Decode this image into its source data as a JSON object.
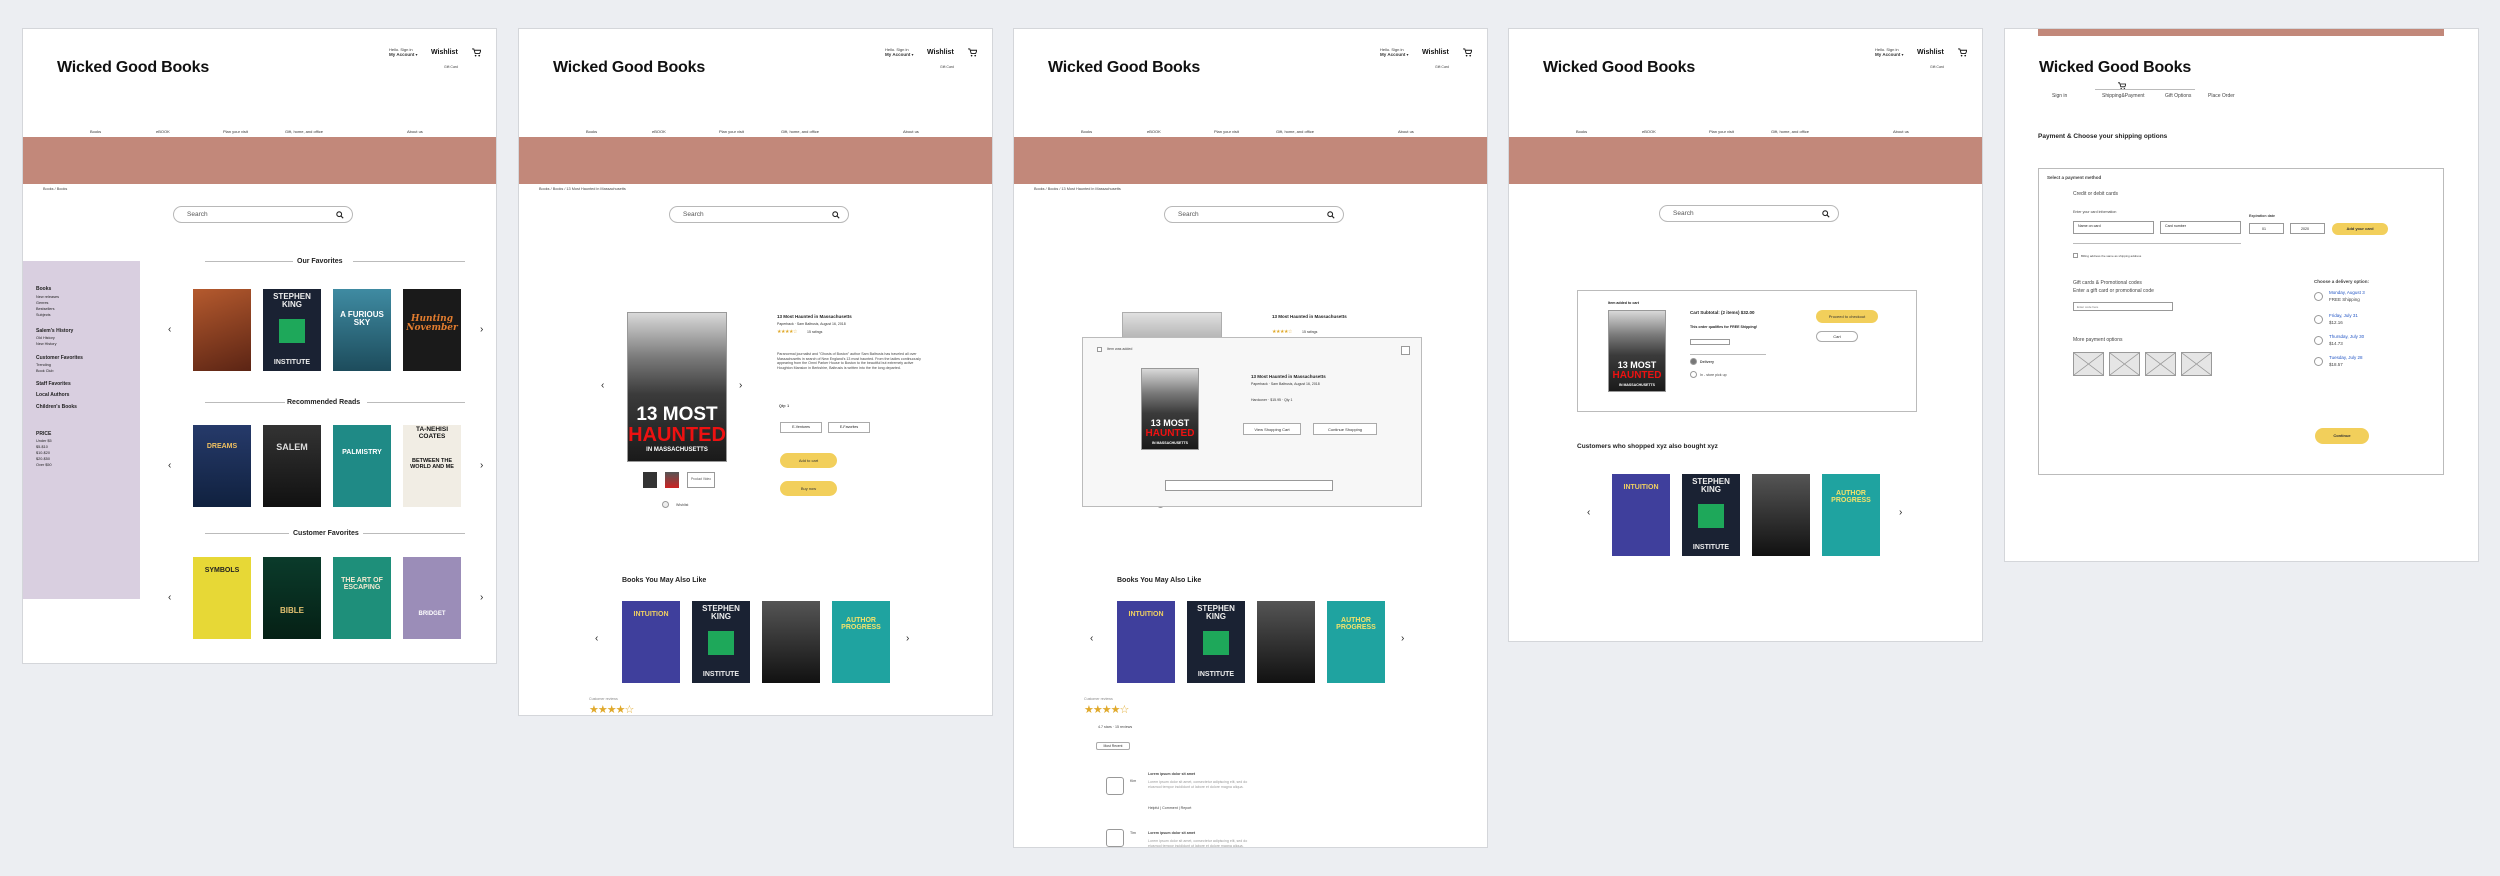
{
  "header": {
    "logo": "Wicked Good Books",
    "account_hello": "Hello. Sign in",
    "account_label": "My Account",
    "wishlist": "Wishlist",
    "gift_card": "Gift Card",
    "cart_icon": "cart-icon"
  },
  "nav": [
    "Books",
    "eBOOK",
    "Plan your visit",
    "Gift, home, and office",
    "About us"
  ],
  "search": {
    "placeholder": "Search"
  },
  "crumbs": {
    "f1": "Books / Books",
    "f2": "Books / Books / 13 Most Haunted in Massachusetts",
    "f3": "Books / Books / 13 Most Haunted in Massachusetts"
  },
  "frame1": {
    "sidebar": {
      "books": "Books",
      "books_items": [
        "New releases",
        "Genres",
        "Bestsellers",
        "Subjects"
      ],
      "salem": "Salem's History",
      "salem_items": [
        "Old History",
        "New History"
      ],
      "favorites": "Customer Favorites",
      "favorites_items": [
        "Trending",
        "Book Club"
      ],
      "staff": "Staff Favorites",
      "local": "Local Authors",
      "children": "Children's Books",
      "price": "PRICE",
      "price_items": [
        "Under $5",
        "$5-$10",
        "$10-$20",
        "$20-$50",
        "Over $50"
      ]
    },
    "sections": [
      "Our Favorites",
      "Recommended Reads",
      "Customer Favorites"
    ],
    "row1": [
      "",
      "STEPHEN KING",
      "A FURIOUS SKY",
      "Hunting November"
    ],
    "row1_sub": [
      "",
      "INSTITUTE",
      "",
      ""
    ],
    "row2": [
      "DREAMS",
      "SALEM",
      "PALMISTRY",
      "TA-NEHISI COATES"
    ],
    "row2_sub": [
      "",
      "",
      "",
      "BETWEEN THE WORLD AND ME"
    ],
    "row3": [
      "SYMBOLS",
      "BIBLE",
      "THE ART OF ESCAPING",
      "BRIDGET"
    ],
    "row3_sub": [
      "",
      "",
      "",
      ""
    ]
  },
  "product": {
    "cover_13": "13 MOST",
    "cover_haunted": "HAUNTED",
    "cover_in": "IN MASSACHUSETTS",
    "title": "13 Most Haunted in Massachusetts",
    "meta": "Paperback · Sam Baltrusis, August 16, 2018",
    "stars": "★★★★☆",
    "ratings": "15 ratings",
    "description": "Paranormal journalist and \"Ghosts of Boston\" author Sam Baltrusis has traveled all over Massachusetts in search of New England's 13 most haunted. From the ladies continuously appearing from the Omni Parker House to Boston to the beautiful but extremely active Houghton Mansion in Berkshire, Baltrusis is written into the the long departed.",
    "qty": "Qty: 1",
    "format1": "E-Ventures",
    "format2": "E-Favorites",
    "add_to_cart": "Add to cart",
    "buy_now": "Buy now",
    "wishlist": "Wishlist",
    "thumb_more": "Product Video",
    "you_may_like": "Books You May Also Like",
    "customer_reviews": "Customer reviews",
    "review_stars": "★★★★☆"
  },
  "frame3": {
    "modal_check": "Item was added",
    "view_cart": "View Shopping Cart",
    "continue": "Continue Shopping",
    "modal_hard": "Hardcover · $15.95 · Qty 1",
    "review_count": "4.7 stars · 15 reviews",
    "filter": "Most Recent",
    "review_title": "Lorem ipsum dolor sit amet",
    "review_body": "Lorem ipsum dolor sit amet, consectetur adipiscing elit, sed do eiusmod tempor incididunt ut labore et dolore magna aliqua.",
    "review_actions": "Helpful  |  Comment  |  Report",
    "reviewer1": "Kim",
    "reviewer2": "Tim"
  },
  "frame4": {
    "added": "Item added to cart",
    "subtotal": "Cart Subtotal: (2 items) $32.00",
    "free_shipping": "This order qualifies for FREE Shipping!",
    "proceed": "Proceed to checkout",
    "cart": "Cart",
    "delivery": "Delivery",
    "pickup": "In - store pick up",
    "also_bought": "Customers who shopped xyz also bought xyz",
    "books": [
      "INTUITION",
      "STEPHEN KING",
      "",
      "AUTHOR PROGRESS"
    ]
  },
  "frame5": {
    "steps": [
      "Sign in",
      "Shipping&Payment",
      "Gift Options",
      "Place Order"
    ],
    "heading": "Payment & Choose your shipping options",
    "select_method": "Select a payment method",
    "credit": "Credit or debit cards",
    "enter_card": "Enter your card information",
    "name_on_card": "Name on card",
    "card_number": "Card number",
    "expiration": "Expiration date",
    "month": "01",
    "year": "2020",
    "add_card": "Add your card",
    "billing_check": "Billing address the same as shipping address",
    "gift_heading": "Gift cards & Promotional codes",
    "gift_sub": "Enter a gift card or promotional code",
    "code_placeholder": "Enter code here",
    "more_options": "More payment options",
    "delivery_heading": "Choose a delivery option:",
    "delivery": [
      {
        "date": "Monday, August 3",
        "price": "FREE Shipping"
      },
      {
        "date": "Friday, July 31",
        "price": "$12.16"
      },
      {
        "date": "Thursday, July 30",
        "price": "$14.73"
      },
      {
        "date": "Tuesday, July 28",
        "price": "$18.57"
      }
    ],
    "continue": "Continue"
  },
  "colors": {
    "banner": "#c2887a",
    "sidebar": "#d9cfe0",
    "button": "#f2cf5b",
    "link": "#2457c5"
  }
}
